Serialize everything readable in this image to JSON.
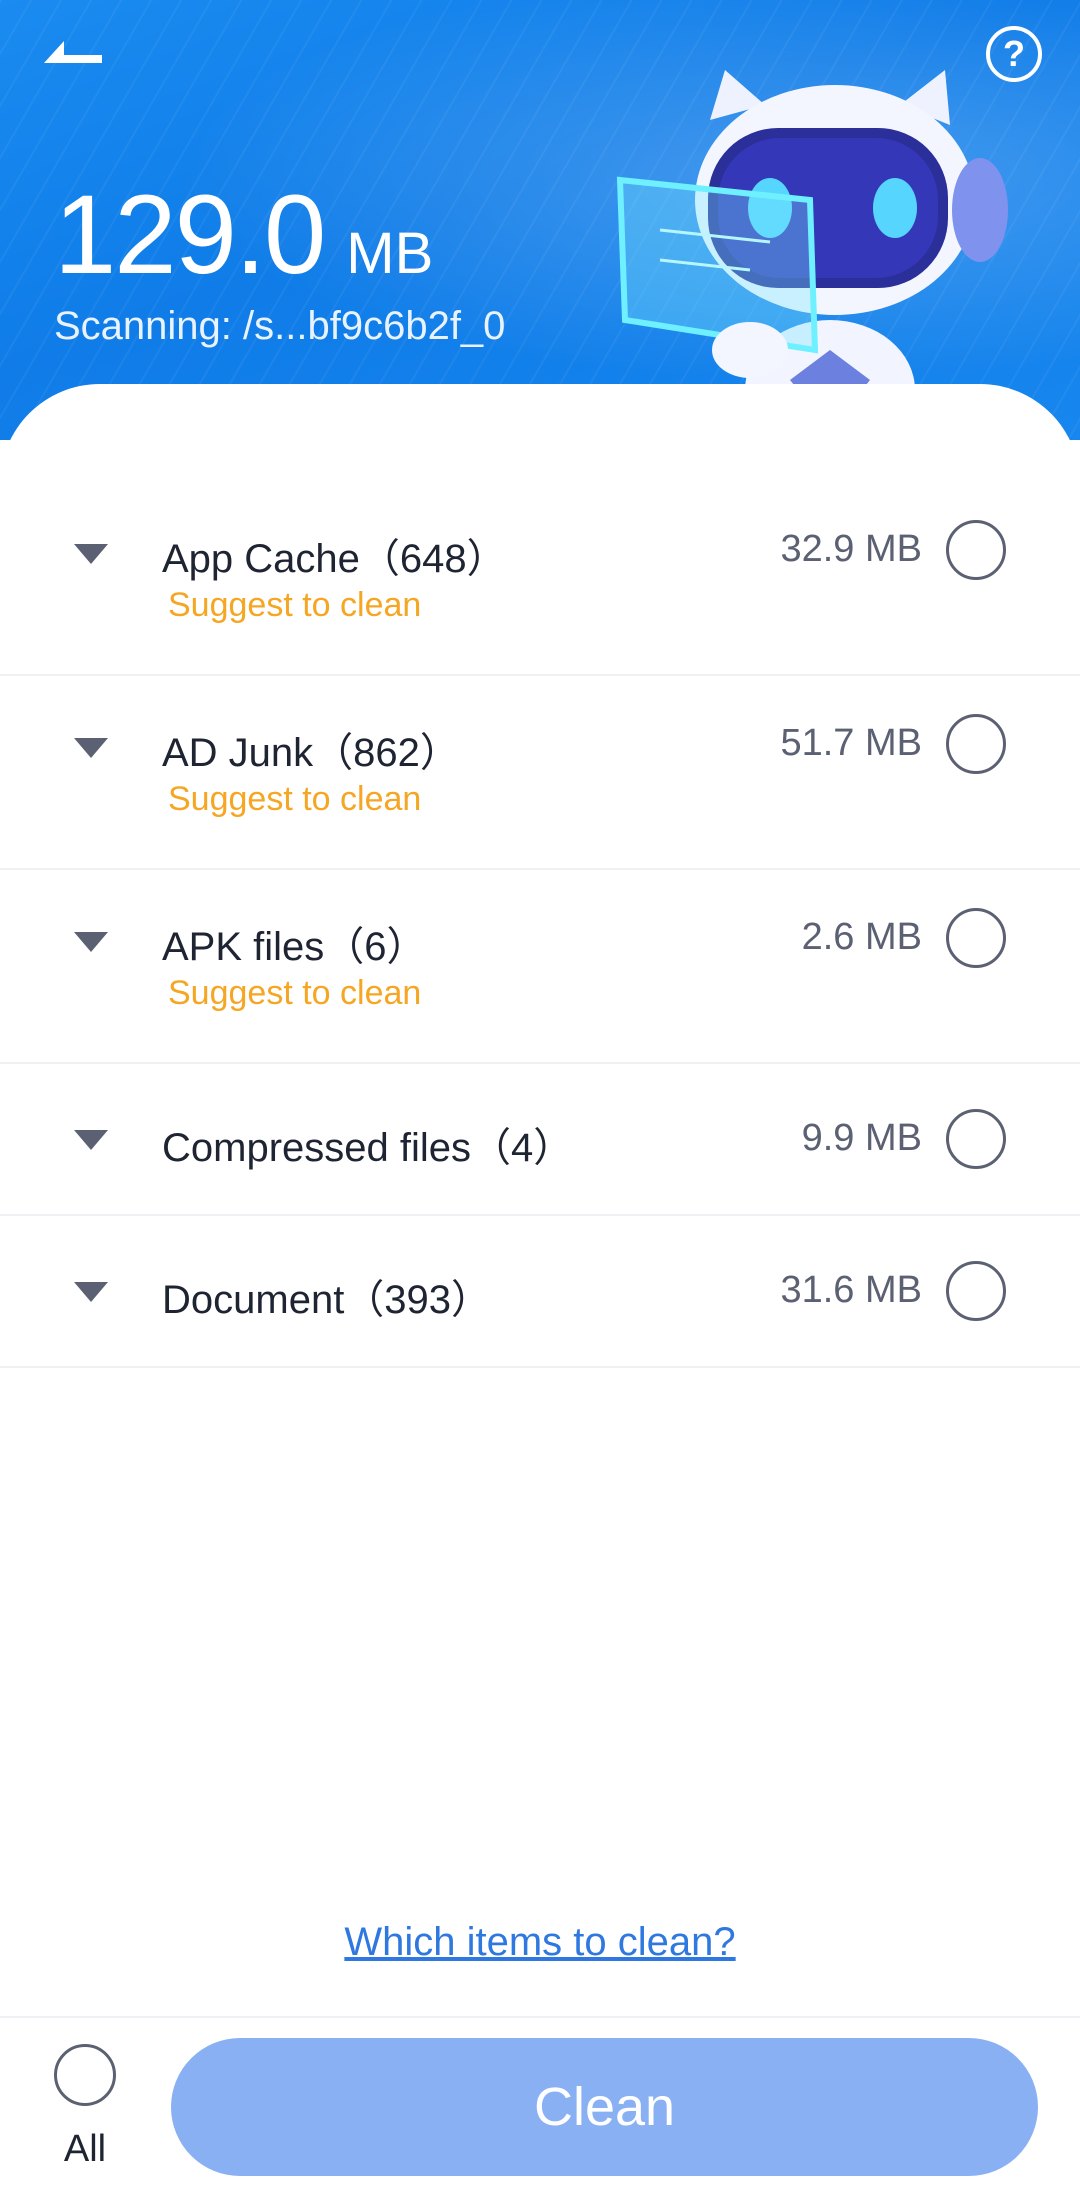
{
  "header": {
    "size_value": "129.0",
    "size_unit": "MB",
    "scanning_text": "Scanning:  /s...bf9c6b2f_0",
    "help_label": "?"
  },
  "categories": [
    {
      "title": "App Cache（648）",
      "size": "32.9 MB",
      "suggest": "Suggest to clean"
    },
    {
      "title": "AD Junk（862）",
      "size": "51.7 MB",
      "suggest": "Suggest to clean"
    },
    {
      "title": "APK files（6）",
      "size": "2.6 MB",
      "suggest": "Suggest to clean"
    },
    {
      "title": "Compressed files（4）",
      "size": "9.9 MB"
    },
    {
      "title": "Document（393）",
      "size": "31.6 MB"
    }
  ],
  "footer": {
    "which_items": "Which items to clean?",
    "all_label": "All",
    "clean_label": "Clean"
  },
  "colors": {
    "header_blue": "#1283ec",
    "suggest_orange": "#f5a623",
    "clean_button": "#8ab0f4",
    "link_blue": "#2f78e0"
  },
  "icons": {
    "back": "back-arrow-icon",
    "help": "help-icon",
    "expand": "caret-down-icon",
    "select": "radio-unchecked-icon"
  }
}
